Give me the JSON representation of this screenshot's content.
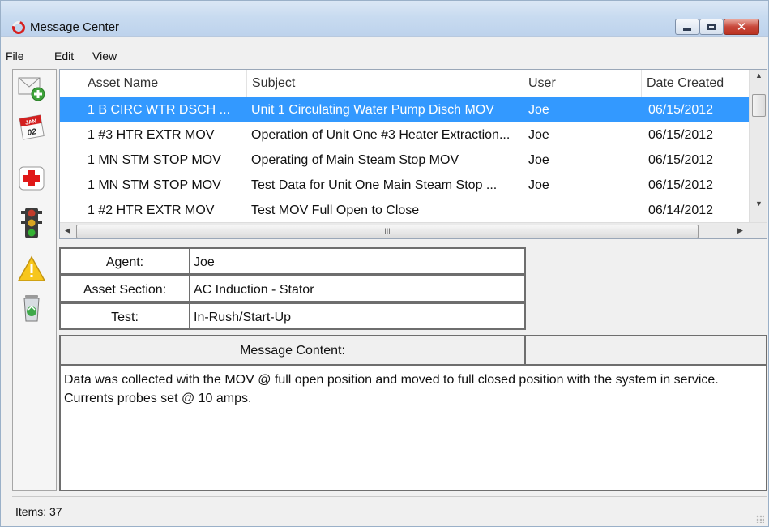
{
  "window": {
    "title": "Message Center"
  },
  "menu": {
    "file": "File",
    "edit": "Edit",
    "view": "View"
  },
  "toolbar": {
    "icons": [
      "new-message-icon",
      "calendar-icon",
      "first-aid-icon",
      "traffic-light-icon",
      "warning-icon",
      "recycle-bin-icon"
    ],
    "calendar_month": "JAN",
    "calendar_day": "02"
  },
  "list": {
    "columns": [
      "Asset Name",
      "Subject",
      "User",
      "Date Created"
    ],
    "rows": [
      {
        "asset": "1 B CIRC WTR DSCH ...",
        "subject": "Unit 1 Circulating Water Pump Disch MOV",
        "user": "Joe",
        "date": "06/15/2012"
      },
      {
        "asset": "1 #3 HTR EXTR MOV",
        "subject": "Operation of Unit One #3 Heater Extraction...",
        "user": "Joe",
        "date": "06/15/2012"
      },
      {
        "asset": "1 MN STM STOP MOV",
        "subject": "Operating of Main Steam Stop MOV",
        "user": "Joe",
        "date": "06/15/2012"
      },
      {
        "asset": "1 MN STM STOP MOV",
        "subject": "Test Data for Unit One Main Steam Stop ...",
        "user": "Joe",
        "date": "06/15/2012"
      },
      {
        "asset": "1 #2 HTR EXTR MOV",
        "subject": "Test MOV Full Open to Close",
        "user": "",
        "date": "06/14/2012"
      }
    ],
    "selected_index": 0,
    "hscroll_grip": "III"
  },
  "detail": {
    "agent_label": "Agent:",
    "agent_value": "Joe",
    "asset_section_label": "Asset Section:",
    "asset_section_value": "AC Induction - Stator",
    "test_label": "Test:",
    "test_value": "In-Rush/Start-Up",
    "message_header": "Message Content:",
    "message_line1": "Data was collected with the MOV @ full open position and moved to full closed position with the system in service.",
    "message_line2": "Currents probes set @ 10 amps."
  },
  "status": {
    "items": "Items: 37"
  },
  "colors": {
    "selection": "#3399ff",
    "close_button": "#c8473a",
    "title_bar": "#c8dbf0"
  }
}
